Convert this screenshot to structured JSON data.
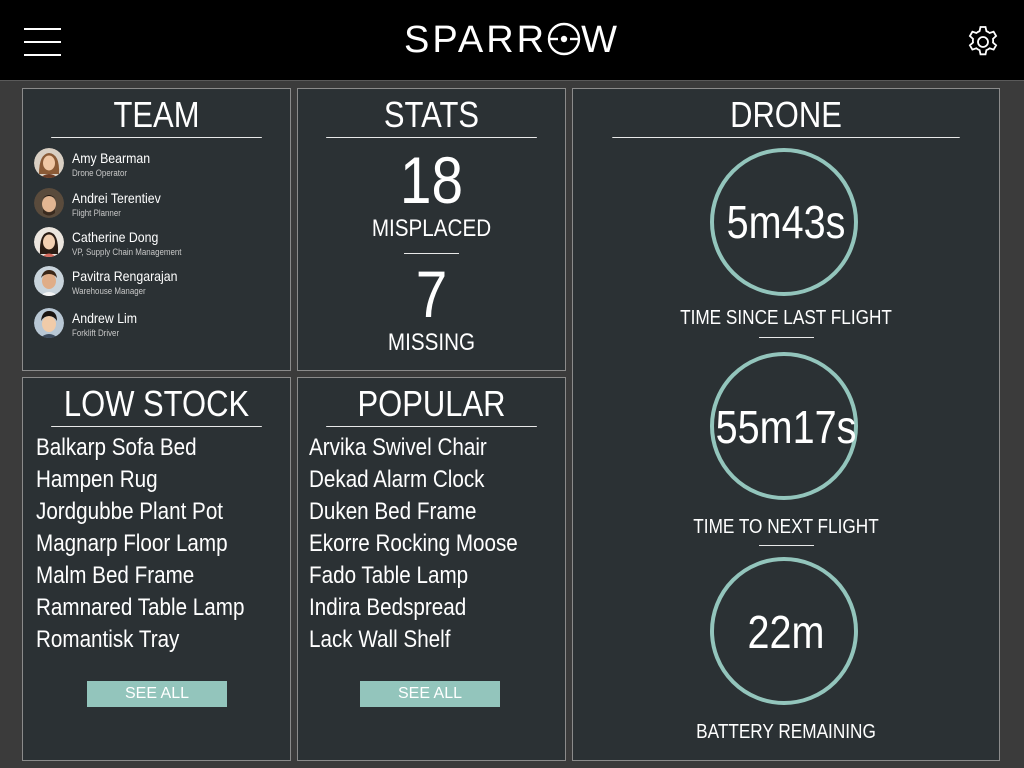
{
  "header": {
    "logo_text_left": "SPARR",
    "logo_text_right": "W"
  },
  "team": {
    "title": "TEAM",
    "members": [
      {
        "name": "Amy Bearman",
        "role": "Drone Operator"
      },
      {
        "name": "Andrei Terentiev",
        "role": "Flight Planner"
      },
      {
        "name": "Catherine Dong",
        "role": "VP, Supply Chain Management"
      },
      {
        "name": "Pavitra Rengarajan",
        "role": "Warehouse Manager"
      },
      {
        "name": "Andrew Lim",
        "role": "Forklift Driver"
      }
    ]
  },
  "stats": {
    "title": "STATS",
    "misplaced_value": "18",
    "misplaced_label": "MISPLACED",
    "missing_value": "7",
    "missing_label": "MISSING"
  },
  "low_stock": {
    "title": "LOW STOCK",
    "items": [
      "Balkarp Sofa Bed",
      "Hampen Rug",
      "Jordgubbe Plant Pot",
      "Magnarp Floor Lamp",
      "Malm Bed Frame",
      "Ramnared Table Lamp",
      "Romantisk Tray"
    ],
    "see_all": "SEE ALL"
  },
  "popular": {
    "title": "POPULAR",
    "items": [
      "Arvika Swivel Chair",
      "Dekad Alarm Clock",
      "Duken Bed Frame",
      "Ekorre Rocking Moose",
      "Fado Table Lamp",
      "Indira Bedspread",
      "Lack Wall Shelf"
    ],
    "see_all": "SEE ALL"
  },
  "drone": {
    "title": "DRONE",
    "metrics": [
      {
        "value": "5m43s",
        "label": "TIME SINCE LAST FLIGHT"
      },
      {
        "value": "55m17s",
        "label": "TIME TO NEXT FLIGHT"
      },
      {
        "value": "22m",
        "label": "BATTERY REMAINING"
      }
    ]
  },
  "colors": {
    "accent": "#93c5bc",
    "panel_bg": "#2b3134",
    "page_bg": "#3b3b3b",
    "header_bg": "#000000"
  }
}
